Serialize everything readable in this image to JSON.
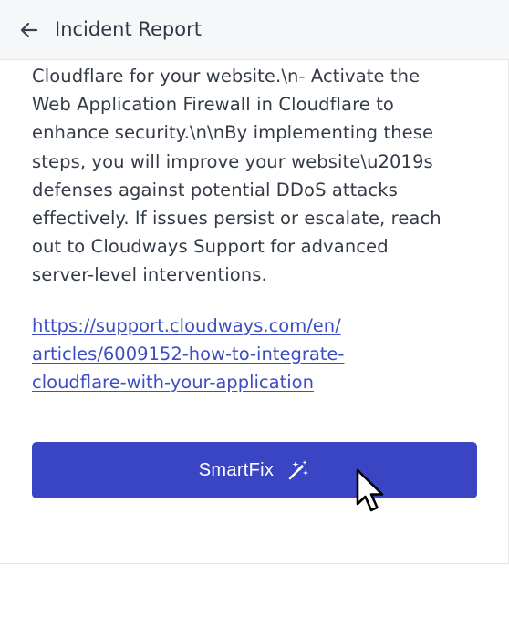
{
  "header": {
    "title": "Incident Report",
    "back_icon": "arrow-left-icon"
  },
  "content": {
    "body_text": "Cloudflare for your website.\\n- Activate the\nWeb Application Firewall in Cloudflare to\nenhance security.\\n\\nBy implementing these\nsteps, you will improve your website\\u2019s\ndefenses against potential DDoS attacks\neffectively. If issues persist or escalate, reach\nout to Cloudways Support for advanced\nserver-level interventions.",
    "link_text": "https://support.cloudways.com/en/\narticles/6009152-how-to-integrate-\ncloudflare-with-your-application"
  },
  "actions": {
    "smartfix_label": "SmartFix",
    "smartfix_icon": "magic-wand-icon"
  },
  "colors": {
    "accent": "#3a45c4",
    "link": "#3d4dc4",
    "header_bg": "#f6f7f9",
    "text": "#333b47"
  }
}
